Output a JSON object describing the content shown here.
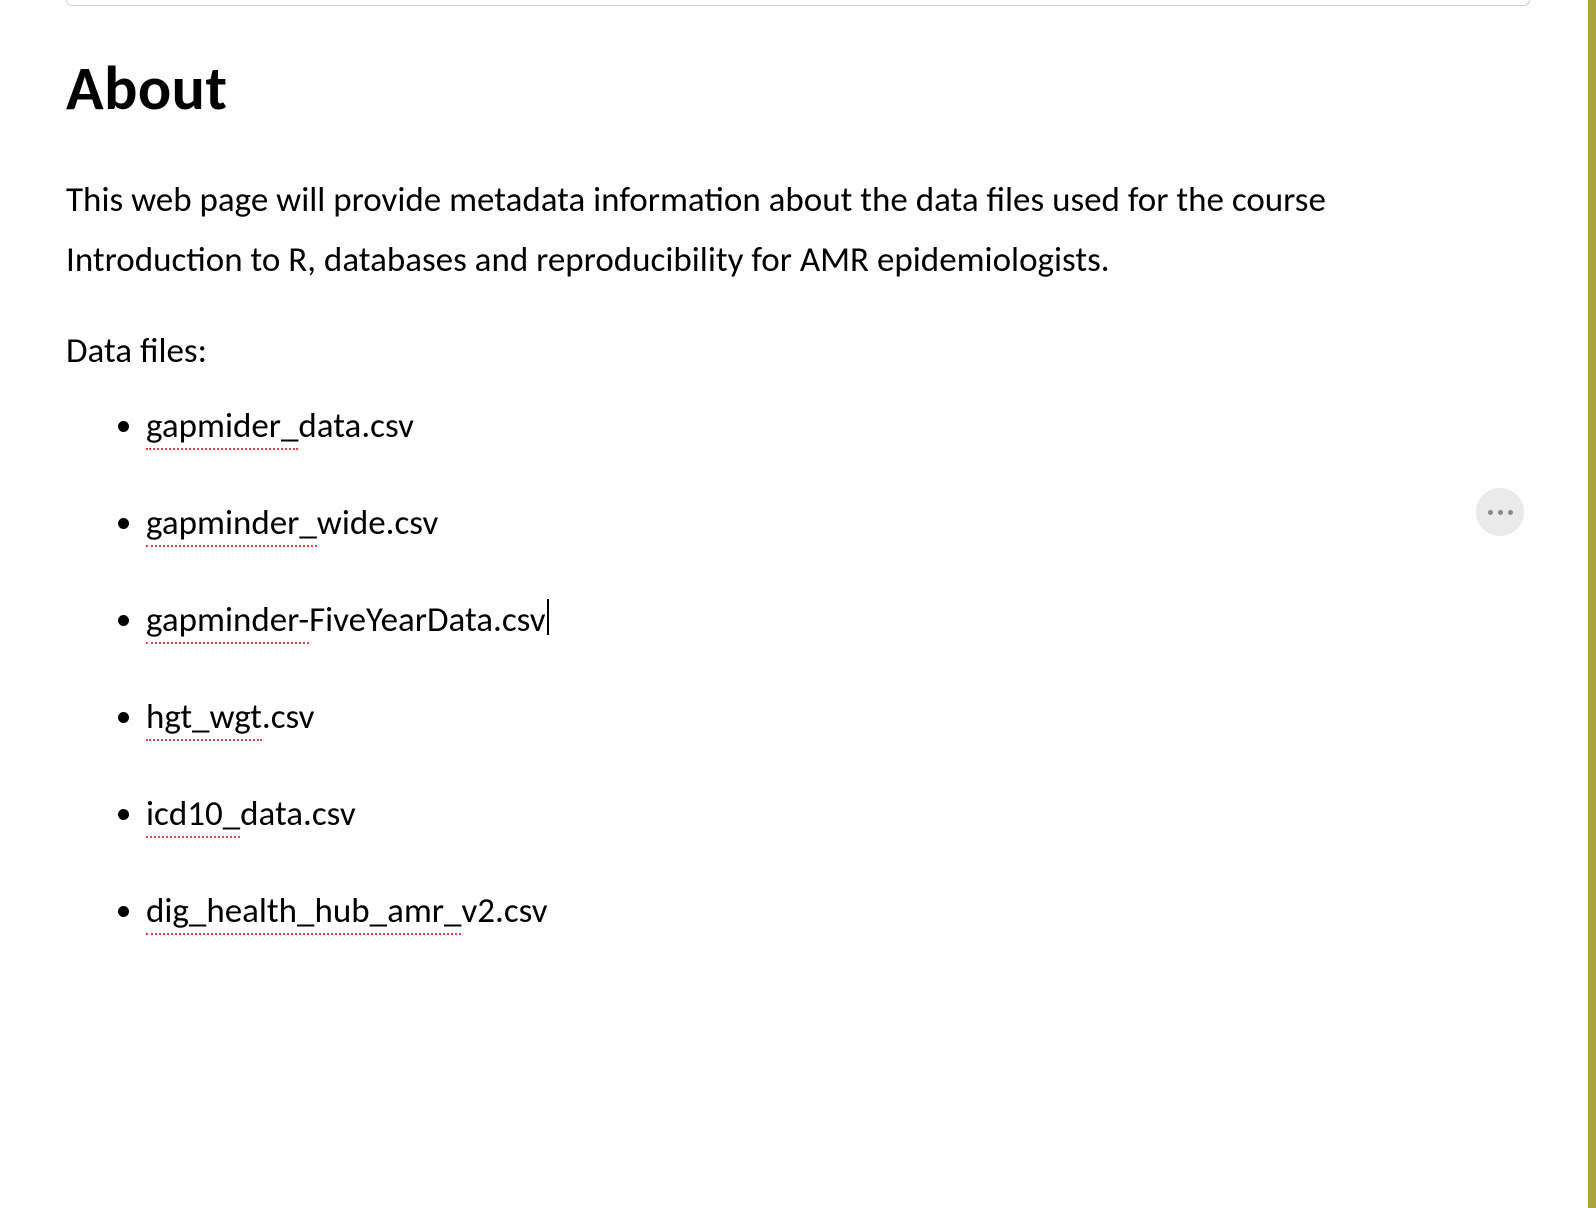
{
  "heading": "About",
  "description": "This web page will provide metadata information about the data files used for the course Introduction to R, databases and reproducibility for AMR epidemiologists.",
  "files_label": "Data files:",
  "files": [
    {
      "spelled": "gapmider_",
      "rest": "data.csv",
      "cursor": false
    },
    {
      "spelled": "gapminder_",
      "rest": "wide.csv",
      "cursor": false
    },
    {
      "spelled": "gapminder-",
      "rest": "FiveYearData.csv",
      "cursor": true
    },
    {
      "spelled": "hgt_wgt",
      "rest": ".csv",
      "cursor": false
    },
    {
      "spelled": "icd10_",
      "rest": "data.csv",
      "cursor": false
    },
    {
      "spelled": "dig_health_hub_amr_",
      "rest": "v2.csv",
      "cursor": false
    }
  ]
}
